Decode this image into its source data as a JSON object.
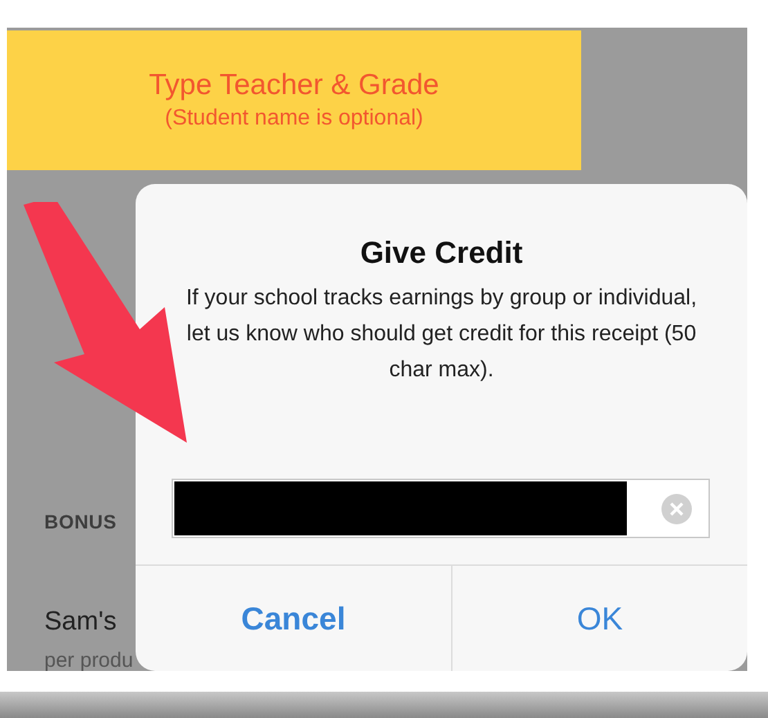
{
  "annotation": {
    "title": "Type Teacher & Grade",
    "subtitle": "(Student name is optional)"
  },
  "background": {
    "section_label": "BONUS",
    "item_title": "Sam's",
    "item_subtitle": "per produ"
  },
  "dialog": {
    "title": "Give Credit",
    "message": "If your school tracks earnings by group or individual, let us know who should get credit for this receipt (50 char max).",
    "input": {
      "redacted": true
    },
    "buttons": [
      {
        "label": "Cancel",
        "kind": "cancel"
      },
      {
        "label": "OK",
        "kind": "default"
      }
    ]
  }
}
